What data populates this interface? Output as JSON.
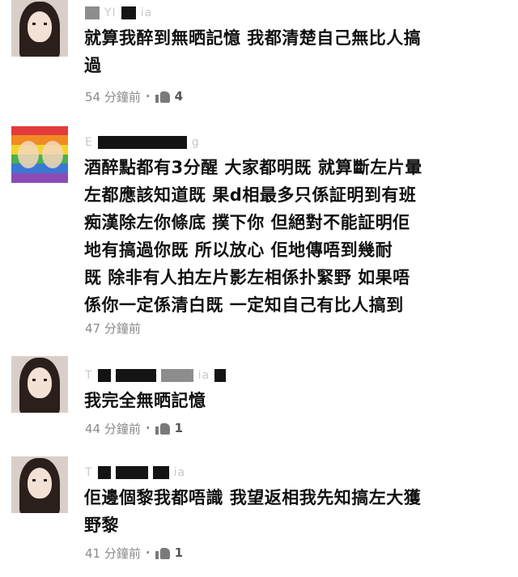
{
  "comments": [
    {
      "name_visible": "YI",
      "name_tail": "ia",
      "text": "就算我醉到無晒記憶 我都清楚自己無比人搞\n過",
      "time": "54 分鐘前",
      "likes": "4"
    },
    {
      "name_visible": "E",
      "name_tail": "g",
      "text": "酒醉點都有3分醒 大家都明既 就算斷左片暈\n左都應該知道既 果d相最多只係証明到有班\n痴漢除左你條底 撲下你 但絕對不能証明佢\n地有搞過你既 所以放心 佢地傳唔到幾耐\n既 除非有人拍左片影左相係扑緊野 如果唔\n係你一定係清白既 一定知自己有比人搞到",
      "time": "47 分鐘前",
      "likes": ""
    },
    {
      "name_visible": "T",
      "name_tail": "ia",
      "text": "我完全無晒記憶",
      "time": "44 分鐘前",
      "likes": "1"
    },
    {
      "name_visible": "T",
      "name_tail": "ia",
      "text": "佢邊個黎我都唔識 我望返相我先知搞左大獲\n野黎",
      "time": "41 分鐘前",
      "likes": "1"
    }
  ]
}
